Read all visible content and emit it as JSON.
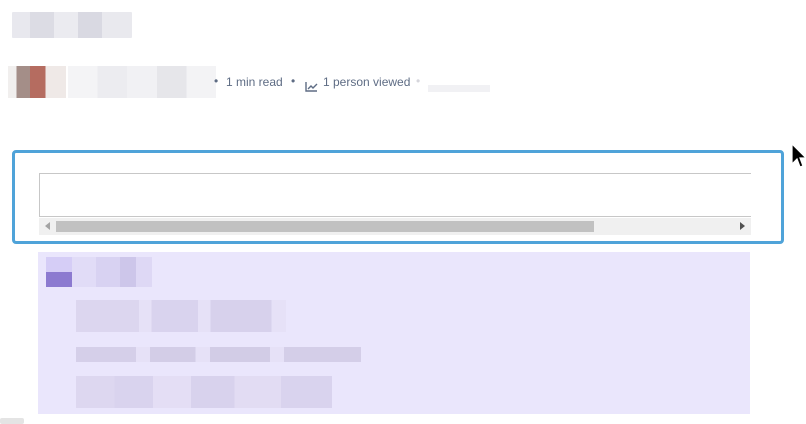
{
  "meta": {
    "read_time": "1 min read",
    "views": "1 person viewed",
    "separator": "•"
  },
  "icons": {
    "trend": "chart-trend-icon",
    "cursor": "mouse-pointer-icon"
  },
  "colors": {
    "frame_border": "#4fa3d9",
    "panel_bg": "#eae6fc",
    "meta_text": "#5e6c84",
    "scroll_track": "#f0f0f0",
    "scroll_thumb": "#c1c1c1"
  }
}
